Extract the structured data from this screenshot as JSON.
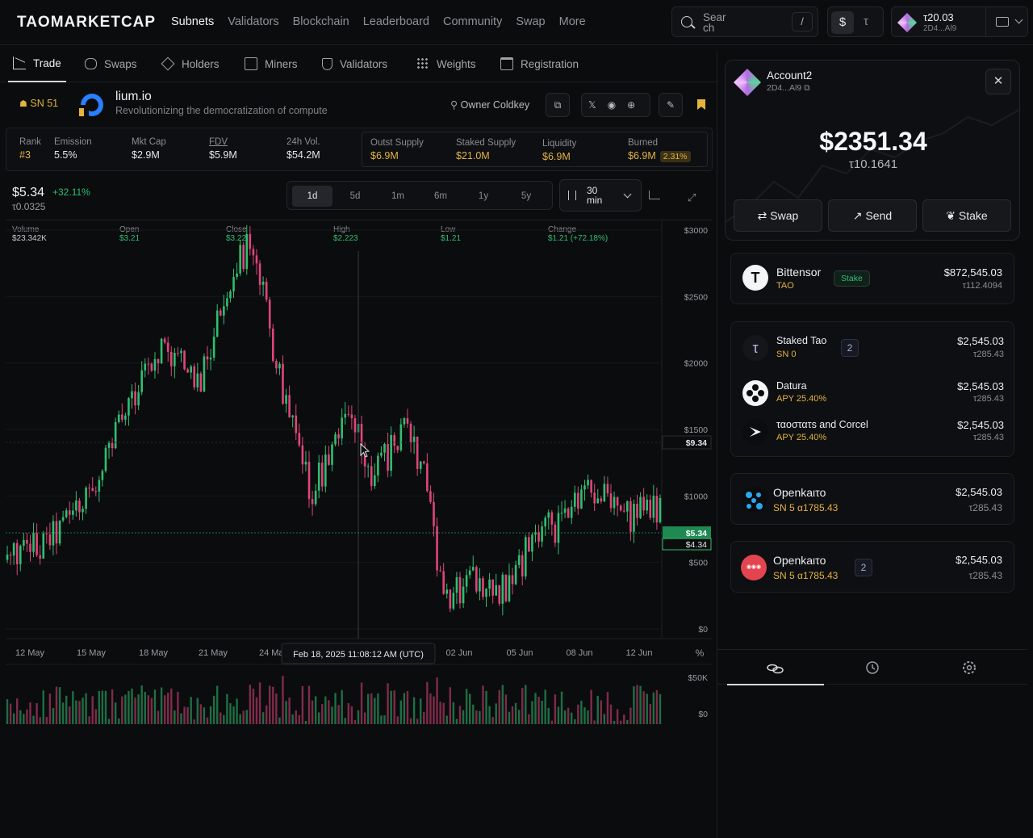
{
  "brand": {
    "logo": "TAOMARKETCAP"
  },
  "nav": {
    "items": [
      "Subnets",
      "Validators",
      "Blockchain",
      "Leaderboard",
      "Community",
      "Swap",
      "More"
    ],
    "active": "Subnets"
  },
  "search": {
    "placeholder": "Search",
    "shortcut": "/"
  },
  "currency": {
    "usd": "$",
    "tao": "τ"
  },
  "wallet": {
    "amount": "τ20.03",
    "address": "2D4...Al9"
  },
  "subnav": {
    "tabs": [
      "Trade",
      "Swaps",
      "Holders",
      "Miners",
      "Validators",
      "Weights",
      "Registration"
    ],
    "active": "Trade"
  },
  "subnet": {
    "badge": "SN 51",
    "name": "lium.io",
    "description": "Revolutionizing the democratization of compute",
    "owner_label": "Owner Coldkey"
  },
  "stats": [
    {
      "label": "Rank",
      "value": "#3"
    },
    {
      "label": "Emission",
      "value": "5.5%"
    },
    {
      "label": "Mkt Cap",
      "value": "$2.9M"
    },
    {
      "label": "FDV",
      "value": "$5.9M"
    },
    {
      "label": "24h Vol.",
      "value": "$54.2M"
    },
    {
      "label": "Outst Supply",
      "value": "$6.9M"
    },
    {
      "label": "Staked Supply",
      "value": "$21.0M"
    },
    {
      "label": "Liquidity",
      "value": "$6.9M"
    },
    {
      "label": "Burned",
      "value": "$6.9M",
      "badge": "2.31%"
    }
  ],
  "price": {
    "usd": "$5.34",
    "change": "+32.11%",
    "tao": "τ0.0325"
  },
  "ranges": {
    "items": [
      "1d",
      "5d",
      "1m",
      "6m",
      "1y",
      "5y"
    ],
    "active": "1d"
  },
  "interval": {
    "label": "30 min"
  },
  "ohlc": [
    {
      "label": "Volume",
      "value": "$23.342K"
    },
    {
      "label": "Open",
      "value": "$3.21"
    },
    {
      "label": "Close",
      "value": "$3.22"
    },
    {
      "label": "High",
      "value": "$2.223"
    },
    {
      "label": "Low",
      "value": "$1.21"
    },
    {
      "label": "Change",
      "value": "$1.21 (+72.18%)"
    }
  ],
  "chart_data": {
    "type": "candlestick",
    "y_ticks": [
      "$3000",
      "$2500",
      "$2000",
      "$1500",
      "$1000",
      "$500",
      "$0"
    ],
    "ylim": [
      0,
      3000
    ],
    "x_ticks": [
      "12 May",
      "15 May",
      "18 May",
      "21 May",
      "24 May",
      "02 Jun",
      "05 Jun",
      "08 Jun",
      "12 Jun"
    ],
    "crosshair_label": "Feb 18, 2025 11:08:12 AM (UTC)",
    "crosshair_price": "$9.34",
    "last_price_label": "$5.34",
    "last_price_label2": "$4.34",
    "percent_toggle": "%",
    "volume_ticks": [
      "$50K",
      "$0"
    ],
    "colors": {
      "up": "#2fbf71",
      "down": "#e0457b"
    },
    "approx_close_path": [
      520,
      560,
      590,
      610,
      640,
      700,
      780,
      860,
      950,
      1050,
      1180,
      1320,
      1480,
      1650,
      1820,
      1950,
      2050,
      2150,
      2060,
      2000,
      1900,
      1850,
      2100,
      2350,
      2600,
      2760,
      2850,
      2700,
      2450,
      2100,
      1780,
      1500,
      1200,
      1050,
      1150,
      1350,
      1500,
      1600,
      1450,
      1250,
      1150,
      1280,
      1380,
      1520,
      1400,
      1250,
      950,
      400,
      120,
      280,
      420,
      380,
      320,
      260,
      310,
      400,
      520,
      640,
      700,
      760,
      780,
      880,
      1020,
      1100,
      1050,
      980,
      930,
      860,
      800,
      900,
      940,
      860
    ]
  },
  "account": {
    "name": "Account2",
    "address": "2D4...Al9",
    "usd": "$2351.34",
    "tao": "τ10.1641",
    "buttons": [
      "Swap",
      "Send",
      "Stake"
    ]
  },
  "bittensor": {
    "name": "Bittensor",
    "symbol": "TAO",
    "pill": "Stake",
    "usd": "$872,545.03",
    "tao": "τ112.4094"
  },
  "staked": {
    "title": "Staked Tao",
    "sn": "SN 0",
    "count": "2",
    "usd": "$2,545.03",
    "tao": "τ285.43",
    "validators": [
      {
        "name": "Datura",
        "apy": "APY 25.40%",
        "usd": "$2,545.03",
        "tao": "τ285.43"
      },
      {
        "name": "ταοστατs and Corcel",
        "apy": "APY 25.40%",
        "usd": "$2,545.03",
        "tao": "τ285.43"
      }
    ]
  },
  "alpha1": {
    "name": "Openkaιτo",
    "sub": "SN 5 α1785.43",
    "usd": "$2,545.03",
    "tao": "τ285.43"
  },
  "alpha2": {
    "name": "Openkaιτo",
    "sub": "SN 5 α1785.43",
    "count": "2",
    "usd": "$2,545.03",
    "tao": "τ285.43"
  }
}
